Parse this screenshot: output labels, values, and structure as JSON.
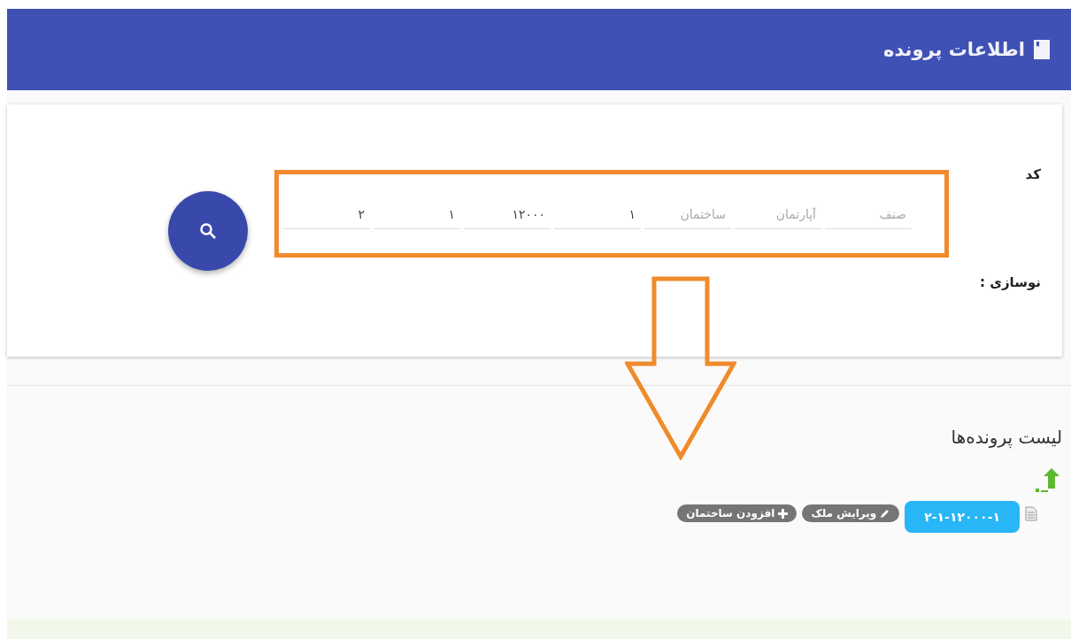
{
  "header": {
    "title": "اطلاعات پرونده"
  },
  "search_form": {
    "code_label": "کد",
    "renovation_label": "نوسازی :",
    "fields": [
      {
        "placeholder": "صنف"
      },
      {
        "placeholder": "آپارتمان"
      },
      {
        "placeholder": "ساختمان"
      },
      {
        "value": "۱"
      },
      {
        "value": "۱۲۰۰۰"
      },
      {
        "value": "۱"
      },
      {
        "value": "۲"
      }
    ]
  },
  "file_list": {
    "title": "لیست پرونده‌ها",
    "items": [
      {
        "code": "۲-۱-۱۲۰۰۰-۱",
        "actions": [
          {
            "kind": "edit",
            "label": "ویرایش ملک"
          },
          {
            "kind": "add",
            "label": "افزودن ساختمان"
          }
        ]
      }
    ]
  }
}
